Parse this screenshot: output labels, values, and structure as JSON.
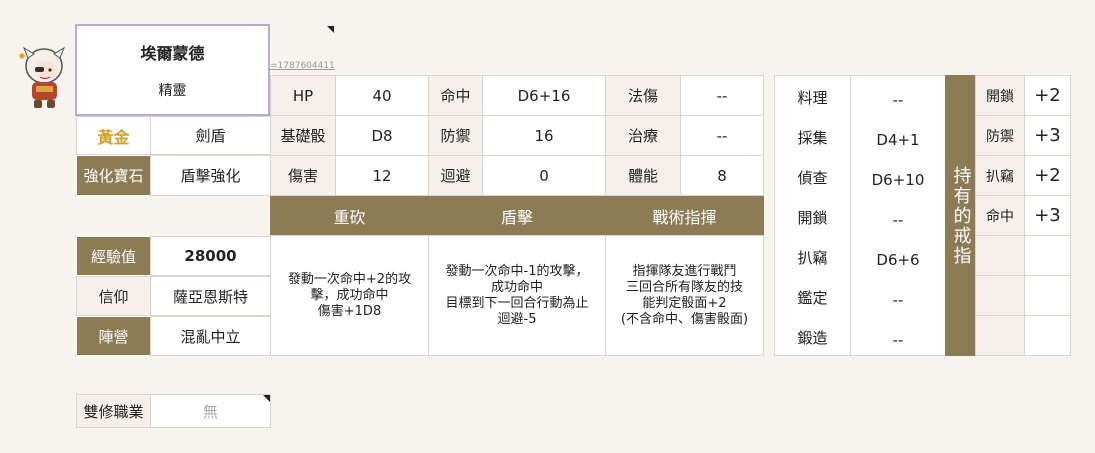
{
  "character": {
    "name": "埃爾蒙德",
    "race": "精靈",
    "id_link": "=1787604411",
    "tier": "黃金",
    "class": "劍盾",
    "tier_color": "#d4a12a"
  },
  "enhance": {
    "label": "強化寶石",
    "value": "盾擊強化"
  },
  "info": [
    {
      "label": "經驗值",
      "value": "28000"
    },
    {
      "label": "信仰",
      "value": "薩亞恩斯特"
    },
    {
      "label": "陣營",
      "value": "混亂中立"
    }
  ],
  "dual_class": {
    "label": "雙修職業",
    "value": "無"
  },
  "stats": {
    "rows": [
      [
        "HP",
        "40",
        "命中",
        "D6+16",
        "法傷",
        "--"
      ],
      [
        "基礎骰",
        "D8",
        "防禦",
        "16",
        "治療",
        "--"
      ],
      [
        "傷害",
        "12",
        "迴避",
        "0",
        "體能",
        "8"
      ]
    ]
  },
  "skills": [
    {
      "name": "重砍",
      "desc": [
        "發動一次命中+2的攻",
        "擊，成功命中",
        "傷害+1D8"
      ]
    },
    {
      "name": "盾擊",
      "desc": [
        "發動一次命中-1的攻擊，",
        "成功命中",
        "目標到下一回合行動為止",
        "迴避-5"
      ]
    },
    {
      "name": "戰術指揮",
      "desc": [
        "指揮隊友進行戰鬥",
        "三回合所有隊友的技",
        "能判定骰面+2",
        "(不含命中、傷害骰面)"
      ]
    }
  ],
  "life_skills": [
    {
      "label": "料理",
      "value": "--"
    },
    {
      "label": "採集",
      "value": "D4+1"
    },
    {
      "label": "偵查",
      "value": "D6+10"
    },
    {
      "label": "開鎖",
      "value": "--"
    },
    {
      "label": "扒竊",
      "value": "D6+6"
    },
    {
      "label": "鑑定",
      "value": "--"
    },
    {
      "label": "鍛造",
      "value": "--"
    }
  ],
  "rings": {
    "header": "持有的戒指",
    "items": [
      {
        "label": "開鎖",
        "value": "+2"
      },
      {
        "label": "防禦",
        "value": "+3"
      },
      {
        "label": "扒竊",
        "value": "+2"
      },
      {
        "label": "命中",
        "value": "+3"
      },
      {
        "label": "",
        "value": ""
      },
      {
        "label": "",
        "value": ""
      },
      {
        "label": "",
        "value": ""
      }
    ]
  },
  "colors": {
    "accent": "#8c7b55",
    "name_border": "#b8a9d6",
    "background": "#f7f3ee"
  },
  "icons": {
    "avatar": "chibi-elf-warrior-avatar"
  }
}
